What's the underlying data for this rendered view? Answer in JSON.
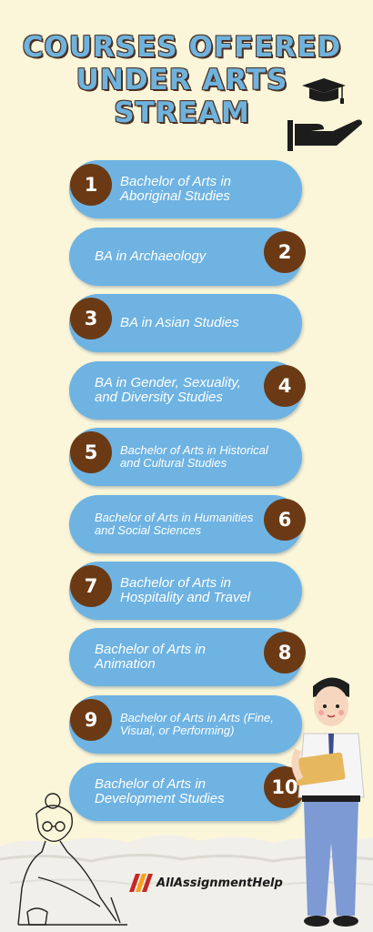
{
  "title_lines": [
    "COURSES OFFERED",
    "UNDER ARTS",
    "STREAM"
  ],
  "courses": [
    {
      "num": "1",
      "label": "Bachelor of Arts in Aboriginal Studies"
    },
    {
      "num": "2",
      "label": "BA in Archaeology"
    },
    {
      "num": "3",
      "label": "BA in Asian Studies"
    },
    {
      "num": "4",
      "label": "BA in Gender, Sexuality, and Diversity Studies"
    },
    {
      "num": "5",
      "label": "Bachelor of Arts in Historical and Cultural Studies"
    },
    {
      "num": "6",
      "label": "Bachelor of Arts in Humanities and Social Sciences"
    },
    {
      "num": "7",
      "label": "Bachelor of Arts in Hospitality and Travel"
    },
    {
      "num": "8",
      "label": "Bachelor of Arts in Animation"
    },
    {
      "num": "9",
      "label": "Bachelor of Arts in Arts (Fine, Visual, or Performing)"
    },
    {
      "num": "10",
      "label": "Bachelor of Arts in Development Studies"
    }
  ],
  "brand": {
    "name": "AllAssignmentHelp"
  },
  "colors": {
    "background": "#fbf6d9",
    "pill": "#6eb3e2",
    "badge": "#6b3a14",
    "title": "#6fb3dc"
  },
  "icons": [
    "graduation-cap-hand-icon",
    "allassignmenthelp-logo-icon"
  ]
}
